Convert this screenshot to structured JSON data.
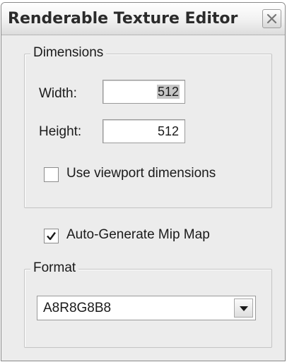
{
  "window": {
    "title": "Renderable Texture Editor",
    "close_icon": "close-icon"
  },
  "dimensions": {
    "legend": "Dimensions",
    "width_label": "Width:",
    "width_value": "512",
    "height_label": "Height:",
    "height_value": "512",
    "use_viewport_label": "Use viewport dimensions",
    "use_viewport_checked": false
  },
  "mipmap": {
    "label": "Auto-Generate Mip Map",
    "checked": true,
    "check_icon": "checkmark-icon"
  },
  "format": {
    "legend": "Format",
    "selected": "A8R8G8B8",
    "dropdown_icon": "dropdown-arrow-icon"
  }
}
